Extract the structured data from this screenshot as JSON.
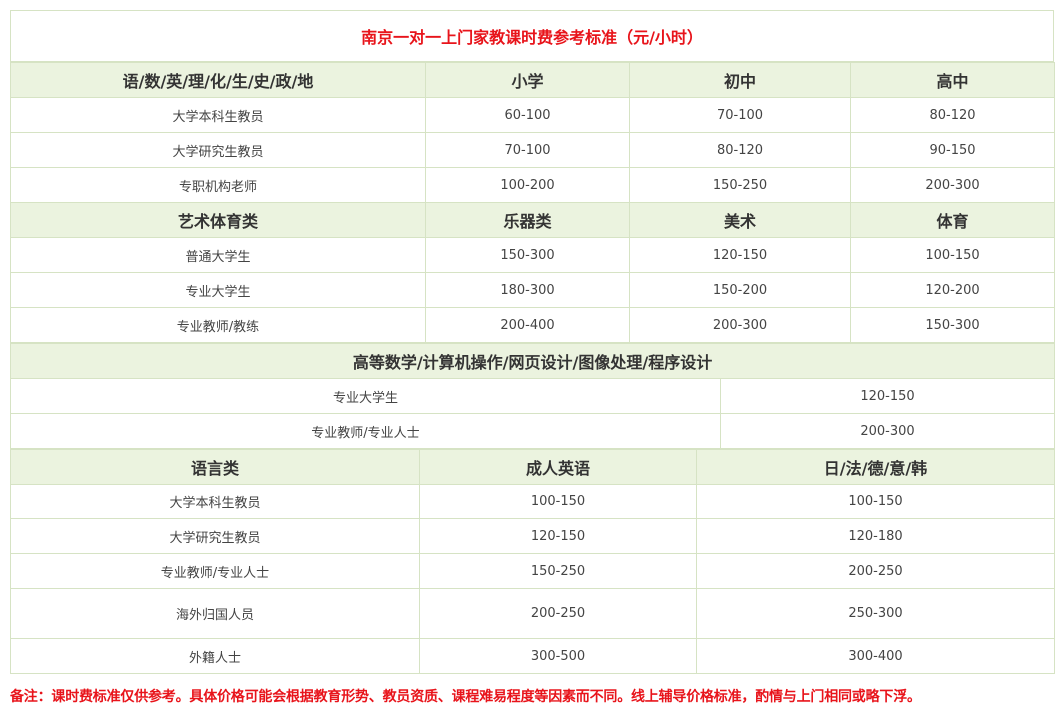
{
  "title": "南京一对一上门家教课时费参考标准（元/小时）",
  "section1": {
    "headers": [
      "语/数/英/理/化/生/史/政/地",
      "小学",
      "初中",
      "高中"
    ],
    "rows": [
      [
        "大学本科生教员",
        "60-100",
        "70-100",
        "80-120"
      ],
      [
        "大学研究生教员",
        "70-100",
        "80-120",
        "90-150"
      ],
      [
        "专职机构老师",
        "100-200",
        "150-250",
        "200-300"
      ]
    ]
  },
  "section2": {
    "headers": [
      "艺术体育类",
      "乐器类",
      "美术",
      "体育"
    ],
    "rows": [
      [
        "普通大学生",
        "150-300",
        "120-150",
        "100-150"
      ],
      [
        "专业大学生",
        "180-300",
        "150-200",
        "120-200"
      ],
      [
        "专业教师/教练",
        "200-400",
        "200-300",
        "150-300"
      ]
    ]
  },
  "section3": {
    "header": "高等数学/计算机操作/网页设计/图像处理/程序设计",
    "rows": [
      [
        "专业大学生",
        "120-150"
      ],
      [
        "专业教师/专业人士",
        "200-300"
      ]
    ]
  },
  "section4": {
    "headers": [
      "语言类",
      "成人英语",
      "日/法/德/意/韩"
    ],
    "rows": [
      [
        "大学本科生教员",
        "100-150",
        "100-150"
      ],
      [
        "大学研究生教员",
        "120-150",
        "120-180"
      ],
      [
        "专业教师/专业人士",
        "150-250",
        "200-250"
      ],
      [
        "海外归国人员",
        "200-250",
        "250-300"
      ],
      [
        "外籍人士",
        "300-500",
        "300-400"
      ]
    ]
  },
  "note": "备注：课时费标准仅供参考。具体价格可能会根据教育形势、教员资质、课程难易程度等因素而不同。线上辅导价格标准，酌情与上门相同或略下浮。",
  "colors": {
    "title_red": "#e8141b",
    "header_bg": "#ebf3df",
    "border": "#d6e3c4"
  }
}
